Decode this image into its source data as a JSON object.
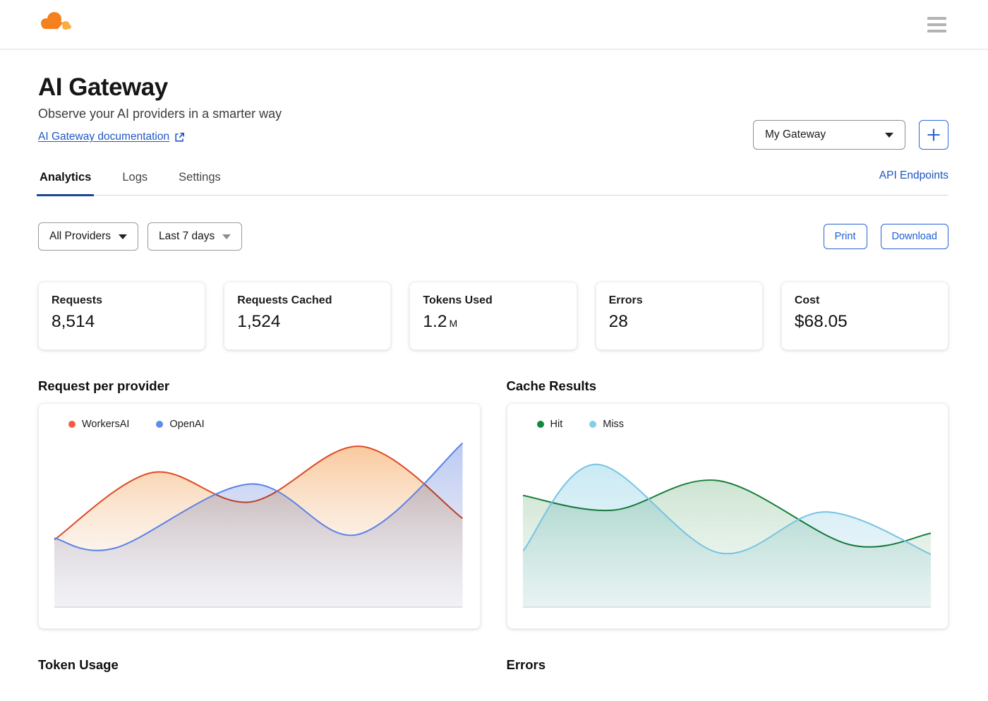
{
  "topnav": {
    "logo": "cloudflare-logo",
    "menu": "hamburger-menu"
  },
  "header": {
    "title": "AI Gateway",
    "subtitle": "Observe your AI providers in a smarter way",
    "doc_link": "AI Gateway documentation",
    "gateway_selected": "My Gateway",
    "add_label": "+"
  },
  "tabs": {
    "items": [
      {
        "label": "Analytics",
        "active": true
      },
      {
        "label": "Logs",
        "active": false
      },
      {
        "label": "Settings",
        "active": false
      }
    ],
    "right_link": "API Endpoints"
  },
  "filters": {
    "provider_selected": "All Providers",
    "range_selected": "Last 7 days",
    "print_label": "Print",
    "download_label": "Download"
  },
  "stats": [
    {
      "label": "Requests",
      "value": "8,514",
      "suffix": ""
    },
    {
      "label": "Requests Cached",
      "value": "1,524",
      "suffix": ""
    },
    {
      "label": "Tokens Used",
      "value": "1.2",
      "suffix": "M"
    },
    {
      "label": "Errors",
      "value": "28",
      "suffix": ""
    },
    {
      "label": "Cost",
      "value": "$68.05",
      "suffix": ""
    }
  ],
  "sections": {
    "bottom_left": "Token Usage",
    "bottom_right": "Errors"
  },
  "colors": {
    "accent_blue": "#2056c4",
    "tab_underline": "#1a478f",
    "workersai": "#f65b40",
    "openai": "#6289f0",
    "hit": "#0f8a3d",
    "miss": "#82cfe9"
  },
  "chart_data": [
    {
      "type": "area",
      "title": "Request per provider",
      "x": "last 7 days (unlabeled axis)",
      "legend_position": "top-left",
      "grid": false,
      "ylim": [
        0,
        100
      ],
      "series": [
        {
          "name": "WorkersAI",
          "legend_color": "#f65b40",
          "stroke": "#dd4b28",
          "fill_top": "rgba(246,168,96,0.62)",
          "fill_bottom": "rgba(244,238,232,0.10)",
          "points": [
            [
              0,
              39
            ],
            [
              24,
              80
            ],
            [
              48,
              62
            ],
            [
              75,
              96
            ],
            [
              100,
              52
            ]
          ]
        },
        {
          "name": "OpenAI",
          "legend_color": "#6289f0",
          "stroke": "#5b82e8",
          "fill_top": "rgba(142,166,236,0.60)",
          "fill_bottom": "rgba(212,214,230,0.28)",
          "points": [
            [
              0,
              40
            ],
            [
              15,
              34
            ],
            [
              48,
              73
            ],
            [
              74,
              42
            ],
            [
              100,
              98
            ]
          ]
        }
      ]
    },
    {
      "type": "area",
      "title": "Cache Results",
      "x": "last 7 days (unlabeled axis)",
      "legend_position": "top-left",
      "grid": false,
      "ylim": [
        0,
        100
      ],
      "series": [
        {
          "name": "Hit",
          "legend_color": "#0f8a3d",
          "stroke": "#177e3b",
          "fill_top": "rgba(163,206,172,0.55)",
          "fill_bottom": "rgba(214,232,222,0.25)",
          "points": [
            [
              0,
              66
            ],
            [
              22,
              57
            ],
            [
              48,
              75
            ],
            [
              80,
              36
            ],
            [
              100,
              43
            ]
          ]
        },
        {
          "name": "Miss",
          "legend_color": "#82cfe9",
          "stroke": "#76c4e2",
          "fill_top": "rgba(158,216,235,0.55)",
          "fill_bottom": "rgba(210,234,238,0.30)",
          "points": [
            [
              0,
              32
            ],
            [
              18,
              85
            ],
            [
              48,
              31
            ],
            [
              74,
              56
            ],
            [
              100,
              30
            ]
          ]
        }
      ]
    }
  ]
}
